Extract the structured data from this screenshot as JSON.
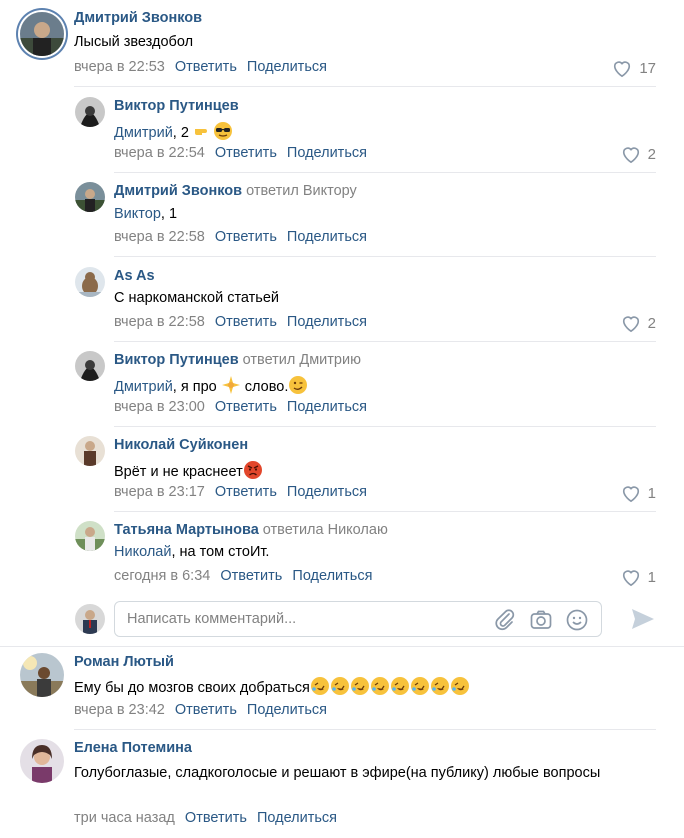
{
  "comments": [
    {
      "author": "Дмитрий Звонков",
      "replied_to": "",
      "addressee": "",
      "text": "Лысый звездобол",
      "time": "вчера в 22:53",
      "reply_label": "Ответить",
      "share_label": "Поделиться",
      "likes": "17"
    },
    {
      "author": "Виктор Путинцев",
      "replied_to": "",
      "addressee": "Дмитрий",
      "text": ", 2",
      "time": "вчера в 22:54",
      "reply_label": "Ответить",
      "share_label": "Поделиться",
      "likes": "2"
    },
    {
      "author": "Дмитрий Звонков",
      "replied_to": "ответил Виктору",
      "addressee": "Виктор",
      "text": ", 1",
      "time": "вчера в 22:58",
      "reply_label": "Ответить",
      "share_label": "Поделиться",
      "likes": ""
    },
    {
      "author": "As As",
      "replied_to": "",
      "addressee": "",
      "text": "С наркоманской статьей",
      "time": "вчера в 22:58",
      "reply_label": "Ответить",
      "share_label": "Поделиться",
      "likes": "2"
    },
    {
      "author": "Виктор Путинцев",
      "replied_to": "ответил Дмитрию",
      "addressee": "Дмитрий",
      "text": ", я про",
      "text2": "слово.",
      "time": "вчера в 23:00",
      "reply_label": "Ответить",
      "share_label": "Поделиться",
      "likes": ""
    },
    {
      "author": "Николай Суйконен",
      "replied_to": "",
      "addressee": "",
      "text": "Врёт и не краснеет",
      "time": "вчера в 23:17",
      "reply_label": "Ответить",
      "share_label": "Поделиться",
      "likes": "1"
    },
    {
      "author": "Татьяна Мартынова",
      "replied_to": "ответила Николаю",
      "addressee": "Николай",
      "text": ", на том стоИт.",
      "time": "сегодня в 6:34",
      "reply_label": "Ответить",
      "share_label": "Поделиться",
      "likes": "1"
    },
    {
      "author": "Роман Лютый",
      "replied_to": "",
      "addressee": "",
      "text": "Ему бы до мозгов своих добраться",
      "time": "вчера в 23:42",
      "reply_label": "Ответить",
      "share_label": "Поделиться",
      "likes": ""
    },
    {
      "author": "Елена Потемина",
      "replied_to": "",
      "addressee": "",
      "text": "Голубоглазые, сладкоголосые и решают в эфире(на публику) любые вопросы",
      "time": "три часа назад",
      "reply_label": "Ответить",
      "share_label": "Поделиться",
      "likes": ""
    }
  ],
  "reply_box": {
    "placeholder": "Написать комментарий..."
  },
  "icons": {
    "like": "heart-icon",
    "attach": "paperclip-icon",
    "camera": "camera-icon",
    "emoji": "smiley-icon",
    "send": "send-icon"
  },
  "colors": {
    "link": "#2a5885",
    "meta": "#828282",
    "separator": "#e7e8ec"
  }
}
